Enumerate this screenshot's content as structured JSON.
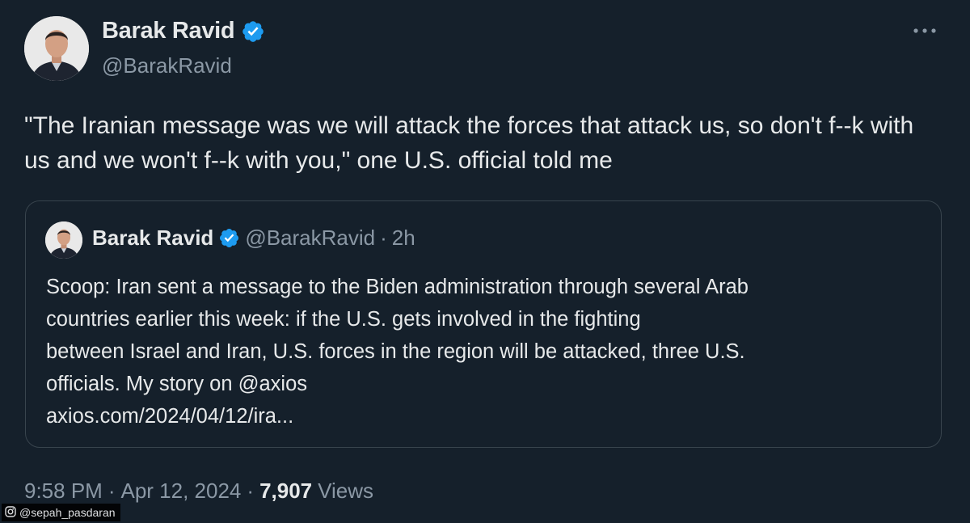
{
  "author": {
    "display_name": "Barak Ravid",
    "handle": "@BarakRavid",
    "verified": true
  },
  "tweet": {
    "text": "\"The Iranian message was we will attack the forces that attack us, so don't f--k with us and we won't f--k with you,\" one U.S. official told me"
  },
  "quote": {
    "display_name": "Barak Ravid",
    "handle": "@BarakRavid",
    "separator": "·",
    "time": "2h",
    "lines": [
      "Scoop: Iran sent a message to the Biden administration through several Arab",
      "countries earlier this week: if the U.S. gets involved in the fighting",
      "between Israel and Iran, U.S. forces in the region will be attacked, three U.S.",
      "officials. My story on @axios",
      "axios.com/2024/04/12/ira..."
    ]
  },
  "meta": {
    "time": "9:58 PM",
    "separator1": "·",
    "date": "Apr 12, 2024",
    "separator2": "·",
    "views_count": "7,907",
    "views_label": "Views"
  },
  "watermark": {
    "handle": "@sepah_pasdaran",
    "icon": "instagram-icon"
  },
  "colors": {
    "background": "#15202b",
    "text_primary": "#e7e9ea",
    "text_secondary": "#8b98a5",
    "verified_blue": "#1d9bf0",
    "border": "#38444d"
  },
  "icons": {
    "verified": "verified-badge-icon",
    "more": "more-options-icon"
  }
}
